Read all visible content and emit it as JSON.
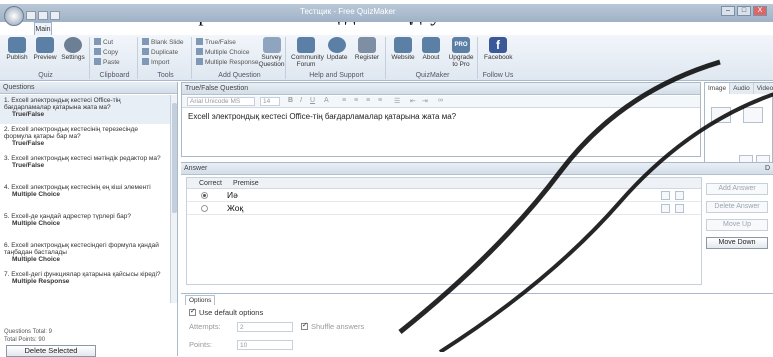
{
  "doc_line": "Вариант – Иә/Жоқ деп таңдауға болатын тест .",
  "window": {
    "title": "Тестщик - Free QuizMaker",
    "minimize": "–",
    "maximize": "□",
    "close": "X"
  },
  "main_tab": "Main",
  "ribbon": {
    "quiz": {
      "name": "Quiz",
      "buttons": [
        "Publish",
        "Preview",
        "Settings"
      ]
    },
    "clipboard": {
      "name": "Clipboard",
      "items": [
        "Cut",
        "Copy",
        "Paste"
      ]
    },
    "tools": {
      "name": "Tools",
      "items": [
        "Blank Slide",
        "Duplicate",
        "Import"
      ]
    },
    "add_question": {
      "name": "Add Question",
      "items": [
        "True/False",
        "Multiple Choice",
        "Multiple Response"
      ],
      "survey": "Survey Question"
    },
    "help": {
      "name": "Help and Support",
      "buttons": [
        "Community Forum",
        "Update",
        "Register"
      ]
    },
    "quizmaker": {
      "name": "QuizMaker",
      "buttons": [
        "Website",
        "About",
        "Upgrade to Pro"
      ],
      "pro_badge": "PRO"
    },
    "follow": {
      "name": "Follow Us",
      "buttons": [
        "Facebook"
      ],
      "fb_glyph": "f"
    }
  },
  "questions_panel": {
    "title": "Questions",
    "items": [
      {
        "text": "1. Excell электрондық кестесі Office-тің бағдарламалар қатарына жата ма?",
        "type": "True/False"
      },
      {
        "text": "2. Excell электрондық кестесінің терезесінде формула қатары бар ма?",
        "type": "True/False"
      },
      {
        "text": "3. Excell электрондық кестесі мәтіндік редактор ма?",
        "type": "True/False"
      },
      {
        "text": "4. Excell электрондық кестесінің ең кіші элементі",
        "type": "Multiple Choice"
      },
      {
        "text": "5. Excell-де қандай адрестер түрлері бар?",
        "type": "Multiple Choice"
      },
      {
        "text": "6. Excell электрондық кестесіндегі формула қандай таңбадан басталады",
        "type": "Multiple Choice"
      },
      {
        "text": "7. Excell-дегі функциялар қатарына қайсысы кіреді?",
        "type": "Multiple Response"
      }
    ],
    "total_questions": "Questions Total: 9",
    "total_points": "Total Points: 90",
    "delete_button": "Delete Selected"
  },
  "editor": {
    "title": "True/False Question",
    "font": "Arial Unicode MS",
    "size": "14",
    "question_text": "Excell электрондық кестесі Office-тің бағдарламалар қатарына жата ма?"
  },
  "media": {
    "tabs": [
      "Image",
      "Audio",
      "Video"
    ]
  },
  "answer": {
    "title": "Answer",
    "col_correct": "Correct",
    "col_premise": "Premise",
    "rows": [
      {
        "premise": "Иә",
        "correct": true
      },
      {
        "premise": "Жоқ",
        "correct": false
      }
    ],
    "buttons": {
      "add": "Add Answer",
      "delete": "Delete Answer",
      "up": "Move Up",
      "down": "Move Down"
    },
    "collapse": "D"
  },
  "options": {
    "tab": "Options",
    "use_default": "Use default options",
    "attempts_label": "Attempts:",
    "attempts_value": "2",
    "shuffle_label": "Shuffle answers",
    "points_label": "Points:",
    "points_value": "10"
  }
}
